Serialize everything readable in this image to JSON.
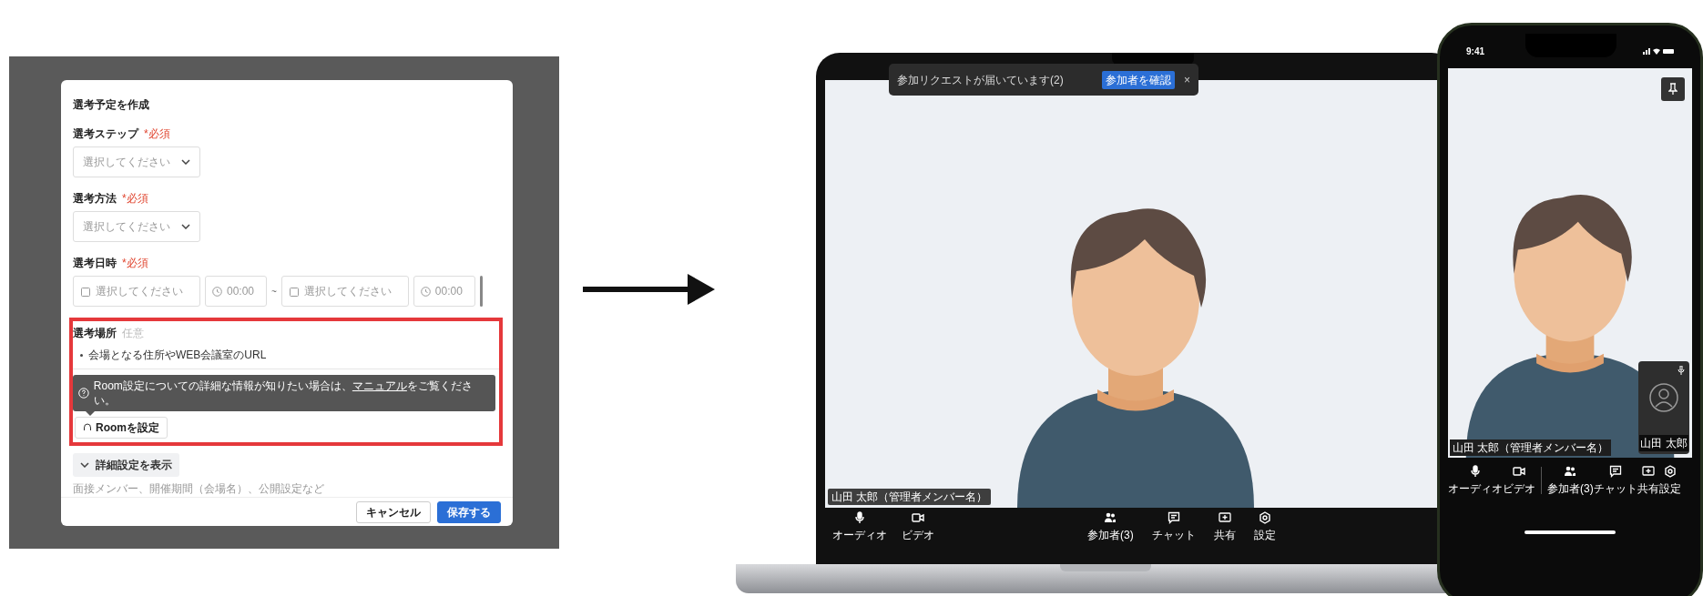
{
  "dialog": {
    "title": "選考予定を作成",
    "fields": [
      {
        "kind": "select",
        "label": "選考ステップ",
        "mark": "*必須",
        "placeholder": "選択してください"
      },
      {
        "kind": "select",
        "label": "選考方法",
        "mark": "*必須",
        "placeholder": "選択してください"
      },
      {
        "kind": "datetime",
        "label": "選考日時",
        "mark": "*必須",
        "start_date": "選択してください",
        "start_time": "00:00",
        "separator": "~",
        "end_date": "選択してください",
        "end_time": "00:00"
      },
      {
        "kind": "location",
        "label": "選考場所",
        "mark": "任意",
        "bullet": "会場となる住所やWEB会議室のURL",
        "tooltip_before": "Room設定についての詳細な情報が知りたい場合は、",
        "tooltip_link": "マニュアル",
        "tooltip_after": "をご覧ください。",
        "button": "Roomを設定"
      }
    ],
    "details_toggle": "詳細設定を表示",
    "details_hint": "面接メンバー、開催期間（会場名）、公開設定など",
    "buttons": [
      {
        "kind": "secondary",
        "label": "キャンセル"
      },
      {
        "kind": "primary",
        "label": "保存する"
      }
    ]
  },
  "laptop": {
    "toast": {
      "text": "参加リクエストが届いています(2)",
      "button": "参加者を確認",
      "close": "×"
    },
    "name_tag": "山田 太郎（管理者メンバー名）",
    "toolbar": [
      {
        "kind": "audio",
        "label": "オーディオ"
      },
      {
        "kind": "video",
        "label": "ビデオ"
      },
      {
        "kind": "participants",
        "label": "参加者(3)"
      },
      {
        "kind": "chat",
        "label": "チャット"
      },
      {
        "kind": "share",
        "label": "共有"
      },
      {
        "kind": "settings",
        "label": "設定"
      }
    ]
  },
  "phone": {
    "time": "9:41",
    "name_tag": "山田 太郎（管理者メンバー名）",
    "self_view_name": "山田 太郎",
    "toolbar": [
      {
        "kind": "audio",
        "label": "オーディオ"
      },
      {
        "kind": "video",
        "label": "ビデオ"
      },
      {
        "kind": "participants",
        "label": "参加者(3)"
      },
      {
        "kind": "chat",
        "label": "チャット"
      },
      {
        "kind": "share",
        "label": "共有"
      },
      {
        "kind": "settings",
        "label": "設定"
      }
    ]
  }
}
